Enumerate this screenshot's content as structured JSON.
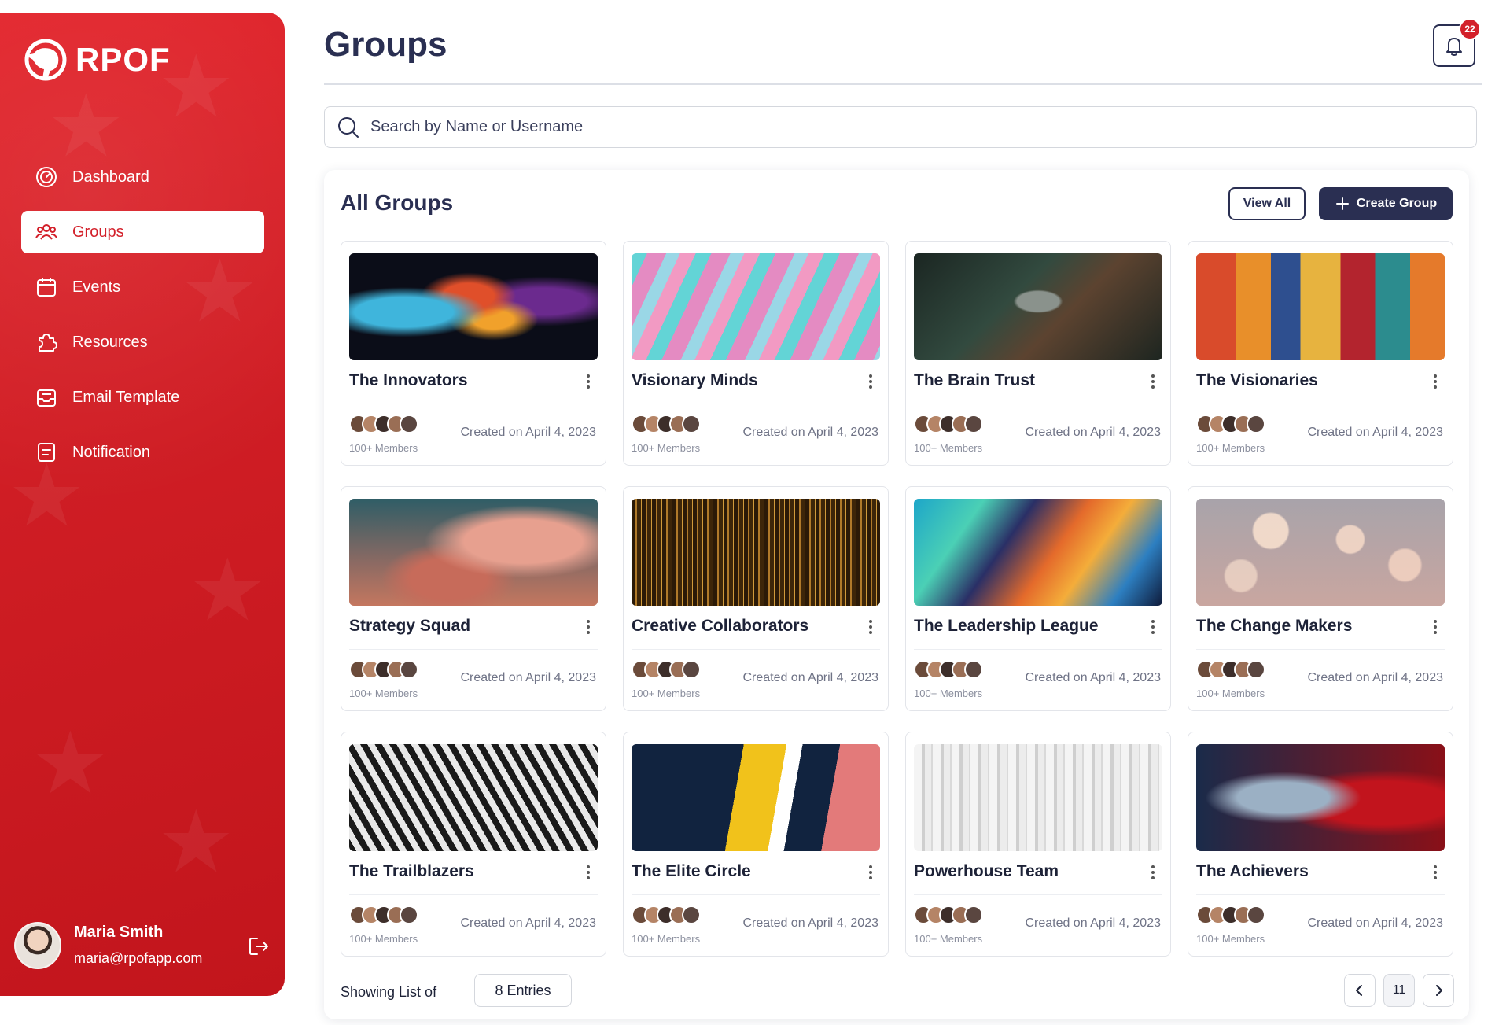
{
  "brand": {
    "name": "RPOF"
  },
  "nav": [
    {
      "id": "dashboard",
      "label": "Dashboard",
      "icon": "dashboard-gauge-icon",
      "active": false
    },
    {
      "id": "groups",
      "label": "Groups",
      "icon": "users-group-icon",
      "active": true
    },
    {
      "id": "events",
      "label": "Events",
      "icon": "calendar-icon",
      "active": false
    },
    {
      "id": "resources",
      "label": "Resources",
      "icon": "puzzle-icon",
      "active": false
    },
    {
      "id": "email-template",
      "label": "Email Template",
      "icon": "inbox-icon",
      "active": false
    },
    {
      "id": "notification",
      "label": "Notification",
      "icon": "document-icon",
      "active": false
    }
  ],
  "user": {
    "name": "Maria Smith",
    "email": "maria@rpofapp.com"
  },
  "header": {
    "title": "Groups",
    "notification_count": "22"
  },
  "search": {
    "placeholder": "Search by Name or Username",
    "value": ""
  },
  "panel": {
    "title": "All Groups",
    "view_all_label": "View All",
    "create_label": "Create Group"
  },
  "groups": [
    {
      "name": "The Innovators",
      "members": "100+ Members",
      "created": "Created on April 4, 2023"
    },
    {
      "name": "Visionary Minds",
      "members": "100+ Members",
      "created": "Created on April 4, 2023"
    },
    {
      "name": "The Brain Trust",
      "members": "100+ Members",
      "created": "Created on April 4, 2023"
    },
    {
      "name": "The Visionaries",
      "members": "100+ Members",
      "created": "Created on April 4, 2023"
    },
    {
      "name": "Strategy Squad",
      "members": "100+ Members",
      "created": "Created on April 4, 2023"
    },
    {
      "name": "Creative Collaborators",
      "members": "100+ Members",
      "created": "Created on April 4, 2023"
    },
    {
      "name": "The Leadership League",
      "members": "100+ Members",
      "created": "Created on April 4, 2023"
    },
    {
      "name": "The Change Makers",
      "members": "100+ Members",
      "created": "Created on April 4, 2023"
    },
    {
      "name": "The Trailblazers",
      "members": "100+ Members",
      "created": "Created on April 4, 2023"
    },
    {
      "name": "The Elite Circle",
      "members": "100+ Members",
      "created": "Created on April 4, 2023"
    },
    {
      "name": "Powerhouse Team",
      "members": "100+ Members",
      "created": "Created on April 4, 2023"
    },
    {
      "name": "The Achievers",
      "members": "100+ Members",
      "created": "Created on April 4, 2023"
    }
  ],
  "footer": {
    "showing_label": "Showing List of",
    "entries_label": "8 Entries",
    "current_page": "11"
  },
  "colors": {
    "accent_red": "#d3202a",
    "navy": "#2a2f52"
  }
}
